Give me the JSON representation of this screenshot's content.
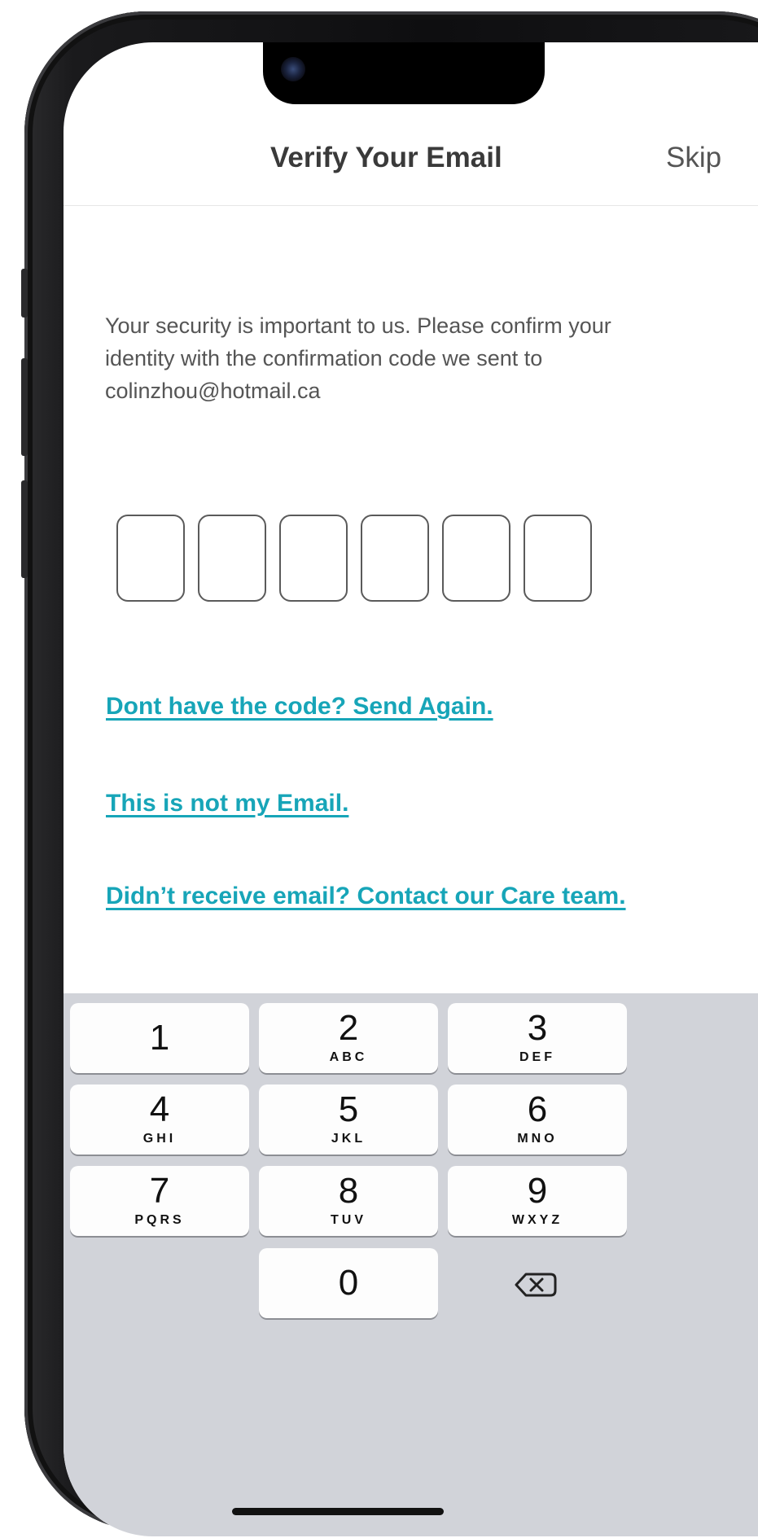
{
  "header": {
    "title": "Verify Your Email",
    "skip_label": "Skip"
  },
  "description": "Your security is important to us. Please confirm your identity with the confirmation code we sent to colinzhou@hotmail.ca",
  "code_inputs": [
    "",
    "",
    "",
    "",
    "",
    ""
  ],
  "links": {
    "send_again": "Dont have the code? Send Again.",
    "not_my_email": "This is not my Email.",
    "contact_care": "Didn’t receive email? Contact our Care team."
  },
  "keypad": {
    "keys": [
      {
        "digit": "1",
        "letters": ""
      },
      {
        "digit": "2",
        "letters": "ABC"
      },
      {
        "digit": "3",
        "letters": "DEF"
      },
      {
        "digit": "4",
        "letters": "GHI"
      },
      {
        "digit": "5",
        "letters": "JKL"
      },
      {
        "digit": "6",
        "letters": "MNO"
      },
      {
        "digit": "7",
        "letters": "PQRS"
      },
      {
        "digit": "8",
        "letters": "TUV"
      },
      {
        "digit": "9",
        "letters": "WXYZ"
      },
      {
        "digit": "0",
        "letters": ""
      }
    ],
    "delete_icon": "backspace-icon"
  },
  "colors": {
    "link": "#17a5b8",
    "keyboard_bg": "#d1d3d9",
    "key_bg": "#fdfdfd"
  }
}
